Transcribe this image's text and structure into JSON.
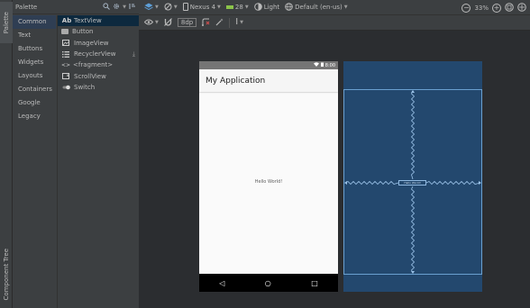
{
  "side_tabs": {
    "palette": "Palette",
    "component_tree": "Component Tree"
  },
  "palette": {
    "title": "Palette",
    "categories": [
      "Common",
      "Text",
      "Buttons",
      "Widgets",
      "Layouts",
      "Containers",
      "Google",
      "Legacy"
    ],
    "selected_category": "Common",
    "widgets": [
      {
        "icon": "Ab",
        "label": "TextView"
      },
      {
        "icon": "button-icon",
        "label": "Button"
      },
      {
        "icon": "image-icon",
        "label": "ImageView"
      },
      {
        "icon": "list-icon",
        "label": "RecyclerView"
      },
      {
        "icon": "<>",
        "label": "<fragment>"
      },
      {
        "icon": "scroll-icon",
        "label": "ScrollView"
      },
      {
        "icon": "toggle-icon",
        "label": "Switch"
      }
    ],
    "selected_widget": "TextView"
  },
  "toolbar": {
    "device": "Nexus 4",
    "api": "28",
    "theme": "Light",
    "locale": "Default (en-us)",
    "default_margin": "8dp",
    "zoom": "33%"
  },
  "phone": {
    "status_time": "8:00",
    "app_title": "My Application",
    "hello_text": "Hello World!",
    "nav_back": "◁",
    "nav_home": "○",
    "nav_recent": "□"
  },
  "blueprint": {
    "text_label": "Hello World!"
  },
  "colors": {
    "selection": "#2f3e53",
    "blueprint": "#23486e",
    "blueprint_line": "#6aa0d0",
    "accent": "#5d9fd8"
  }
}
